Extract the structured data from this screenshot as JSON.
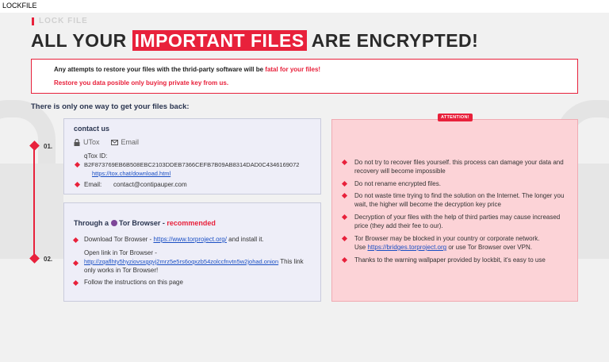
{
  "window": {
    "title": "LOCKFILE"
  },
  "header": {
    "label": "LOCK FILE",
    "headline_pre": "ALL YOUR",
    "headline_highlight": "IMPORTANT FILES",
    "headline_post": "ARE ENCRYPTED!"
  },
  "warning": {
    "line1_pre": "Any attempts to restore your files with the thrid-party software will be",
    "line1_red": "fatal for your files!",
    "line2": "Restore you data posible only buying private key from us."
  },
  "only_way": "There is only one way to get your files back:",
  "steps": [
    "01.",
    "02."
  ],
  "contact": {
    "title": "contact us",
    "tab_utox": "UTox",
    "tab_email": "Email",
    "qtox_label": "qTox ID:",
    "qtox_id": "B2F873769EB6B508EBC2103DDEB7366CEFB7B09AB8314DAD0C4346169072",
    "qtox_link": "https://tox.chat/download.html",
    "email_label": "Email:",
    "email_value": "contact@contipauper.com"
  },
  "tor": {
    "title_pre": "Through a",
    "title_browser": "Tor Browser",
    "title_sep": "-",
    "title_rec": "recommended",
    "download_pre": "Download Tor Browser -",
    "download_link": "https://www.torproject.org/",
    "download_post": "and install it.",
    "open_line1": "Open link in Tor Browser -",
    "open_link": "http://zqaflhty5hyziovsxgqvj2mrz5e5rs6oqxzb54zolccfnvtn5w2johad.onion",
    "open_post": "This link",
    "open_line3": "only works in Tor Browser!",
    "follow": "Follow the instructions on this page"
  },
  "attention": {
    "badge": "ATTENTION!",
    "items": [
      "Do not try to recover files yourself. this process can damage your data and recovery will become impossible",
      "Do not rename encrypted files.",
      "Do not waste time trying to find the solution on the Internet. The longer you wait, the higher will become the decryption key price",
      "Decryption of your files with the help of third parties may cause increased price (they add their fee to our).",
      "Tor Browser may be blocked in your country or corporate network.",
      "Thanks to the warning wallpaper provided by lockbit, it's easy to use"
    ],
    "item5_line2_pre": "Use",
    "item5_link": "https://bridges.torproject.org",
    "item5_line2_post": "or use Tor Browser over VPN."
  },
  "colors": {
    "accent": "#e8213b",
    "attention_bg": "#fcd3d7",
    "card_bg": "#eeeef8"
  }
}
